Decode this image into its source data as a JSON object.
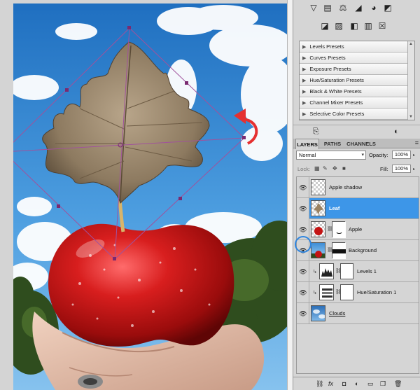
{
  "adjustments": {
    "icons": [
      "brightness-icon",
      "levels-icon",
      "balance-icon",
      "curves-icon",
      "hue-icon",
      "color-balance-icon",
      "invert-icon",
      "posterize-icon",
      "threshold-icon",
      "gradient-map-icon",
      "selective-color-icon"
    ]
  },
  "presets": [
    "Levels Presets",
    "Curves Presets",
    "Exposure Presets",
    "Hue/Saturation Presets",
    "Black & White Presets",
    "Channel Mixer Presets",
    "Selective Color Presets"
  ],
  "layers_panel": {
    "tabs": [
      "LAYERS",
      "PATHS",
      "CHANNELS"
    ],
    "blend_mode": "Normal",
    "opacity_label": "Opacity:",
    "opacity_value": "100%",
    "lock_label": "Lock:",
    "fill_label": "Fill:",
    "fill_value": "100%",
    "layers": [
      {
        "name": "Apple shadow",
        "selected": false
      },
      {
        "name": "Leaf",
        "selected": true
      },
      {
        "name": "Apple",
        "selected": false
      },
      {
        "name": "Background",
        "selected": false
      },
      {
        "name": "Levels 1",
        "selected": false
      },
      {
        "name": "Hue/Saturation 1",
        "selected": false
      },
      {
        "name": "Clouds",
        "selected": false
      }
    ]
  },
  "colors": {
    "selection": "#3d96e8",
    "transform_box": "#a0529c",
    "sky": "#3a8fd6"
  }
}
